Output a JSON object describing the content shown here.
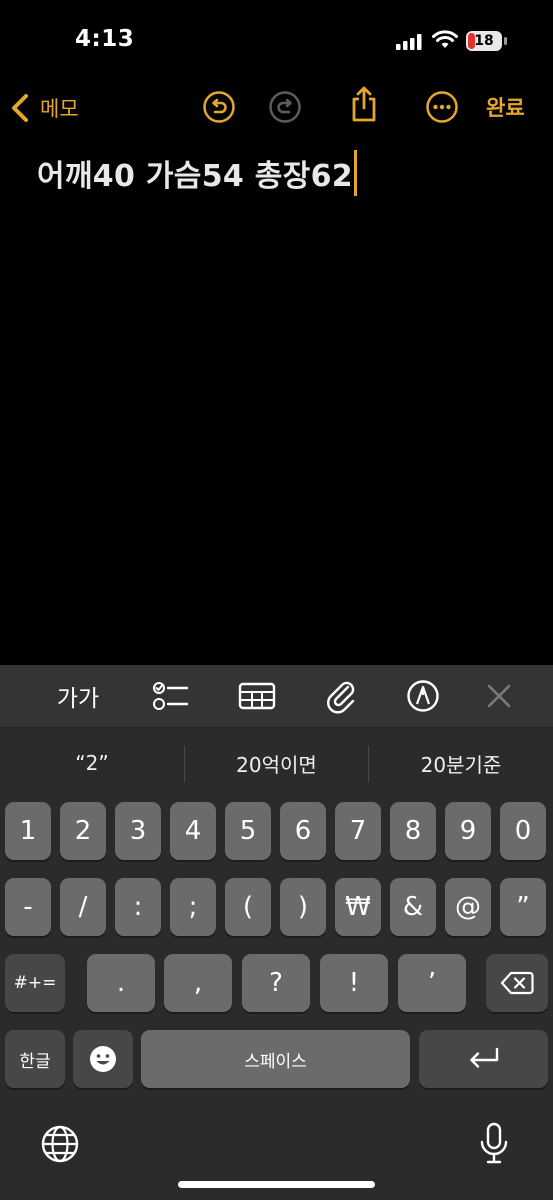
{
  "status_bar": {
    "time": "4:13",
    "battery": "18"
  },
  "nav": {
    "back_label": "메모",
    "done_label": "완료"
  },
  "note": {
    "text": "어깨40 가슴54 총장62"
  },
  "keyboard": {
    "toolbar": {
      "format_label": "가가"
    },
    "suggestions": [
      "“2”",
      "20억이면",
      "20분기준"
    ],
    "row1": [
      "1",
      "2",
      "3",
      "4",
      "5",
      "6",
      "7",
      "8",
      "9",
      "0"
    ],
    "row2": [
      "-",
      "/",
      ":",
      ";",
      "(",
      ")",
      "₩",
      "&",
      "@",
      "”"
    ],
    "row3": {
      "mode": "#+=",
      "keys": [
        ".",
        ",",
        "?",
        "!",
        "’"
      ]
    },
    "row4": {
      "lang": "한글",
      "space": "스페이스"
    }
  },
  "colors": {
    "accent": "#e5a72b",
    "background": "#000000",
    "key": "#6b6b6d",
    "key_dark": "#474749"
  }
}
